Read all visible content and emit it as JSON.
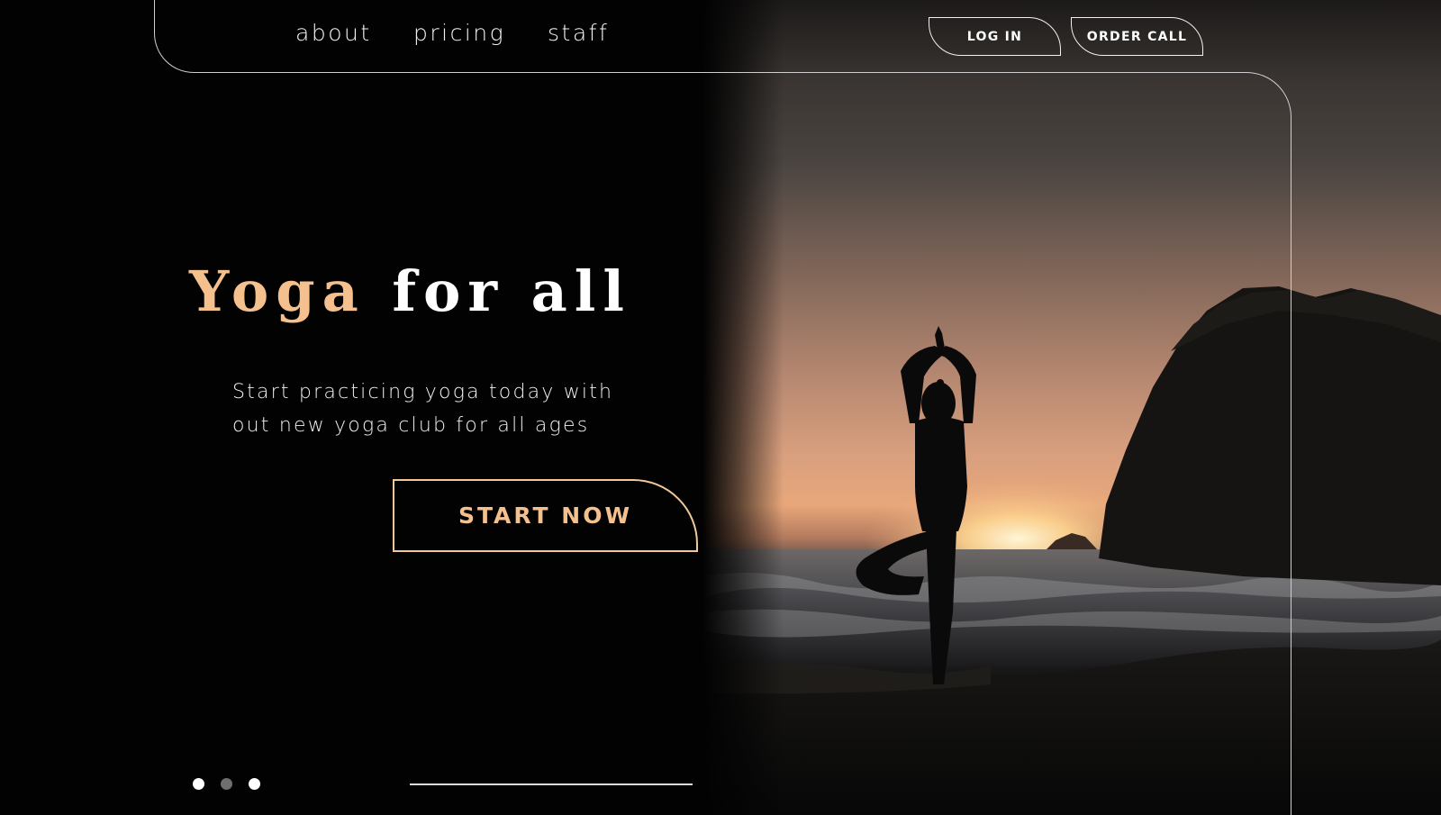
{
  "nav": {
    "links": [
      {
        "label": "about"
      },
      {
        "label": "pricing"
      },
      {
        "label": "staff"
      }
    ],
    "login_label": "LOG IN",
    "order_call_label": "ORDER CALL"
  },
  "hero": {
    "title_accent": "Yoga",
    "title_rest": "for all",
    "subtitle_line1": "Start practicing yoga today with",
    "subtitle_line2": "out new yoga club for all ages",
    "cta_label": "START NOW",
    "image": "yoga-tree-pose-silhouette-at-sunset-beach"
  },
  "carousel": {
    "slide_count": 3,
    "active_index": 0
  },
  "colors": {
    "accent": "#f4c08e",
    "background": "#020202",
    "text": "#ffffff",
    "line": "#cfcfcf"
  }
}
